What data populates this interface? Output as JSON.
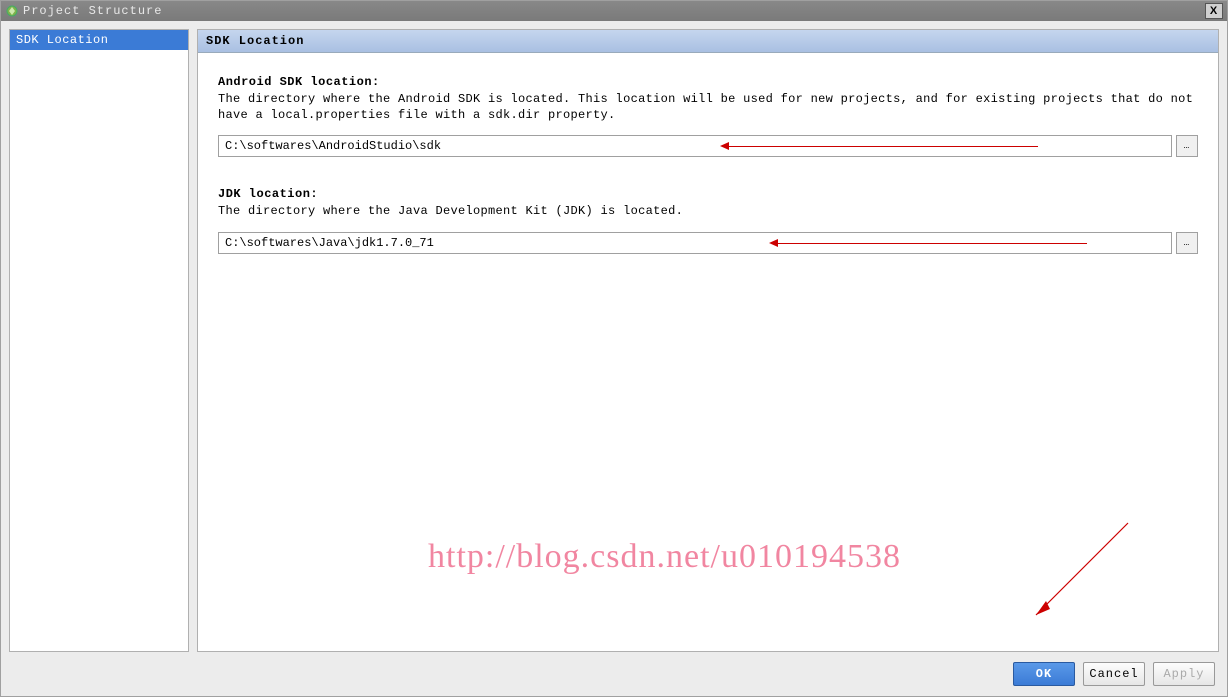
{
  "titlebar": {
    "title": "Project Structure",
    "close_glyph": "X"
  },
  "sidebar": {
    "items": [
      {
        "label": "SDK Location",
        "selected": true
      }
    ]
  },
  "main": {
    "header": "SDK Location",
    "fields": [
      {
        "label": "Android SDK location:",
        "desc": "The directory where the Android SDK is located. This location will be used for new projects, and for existing projects that do not have a local.properties file with a sdk.dir property.",
        "value": "C:\\softwares\\AndroidStudio\\sdk",
        "browse": "…",
        "arrow": {
          "leftPct": 52,
          "widthPx": 310
        }
      },
      {
        "label": "JDK location:",
        "desc": "The directory where the Java Development Kit (JDK) is located.",
        "value": "C:\\softwares\\Java\\jdk1.7.0_71",
        "browse": "…",
        "arrow": {
          "leftPct": 57,
          "widthPx": 310
        }
      }
    ]
  },
  "watermark": "http://blog.csdn.net/u010194538",
  "buttons": {
    "ok": "OK",
    "cancel": "Cancel",
    "apply": "Apply"
  }
}
